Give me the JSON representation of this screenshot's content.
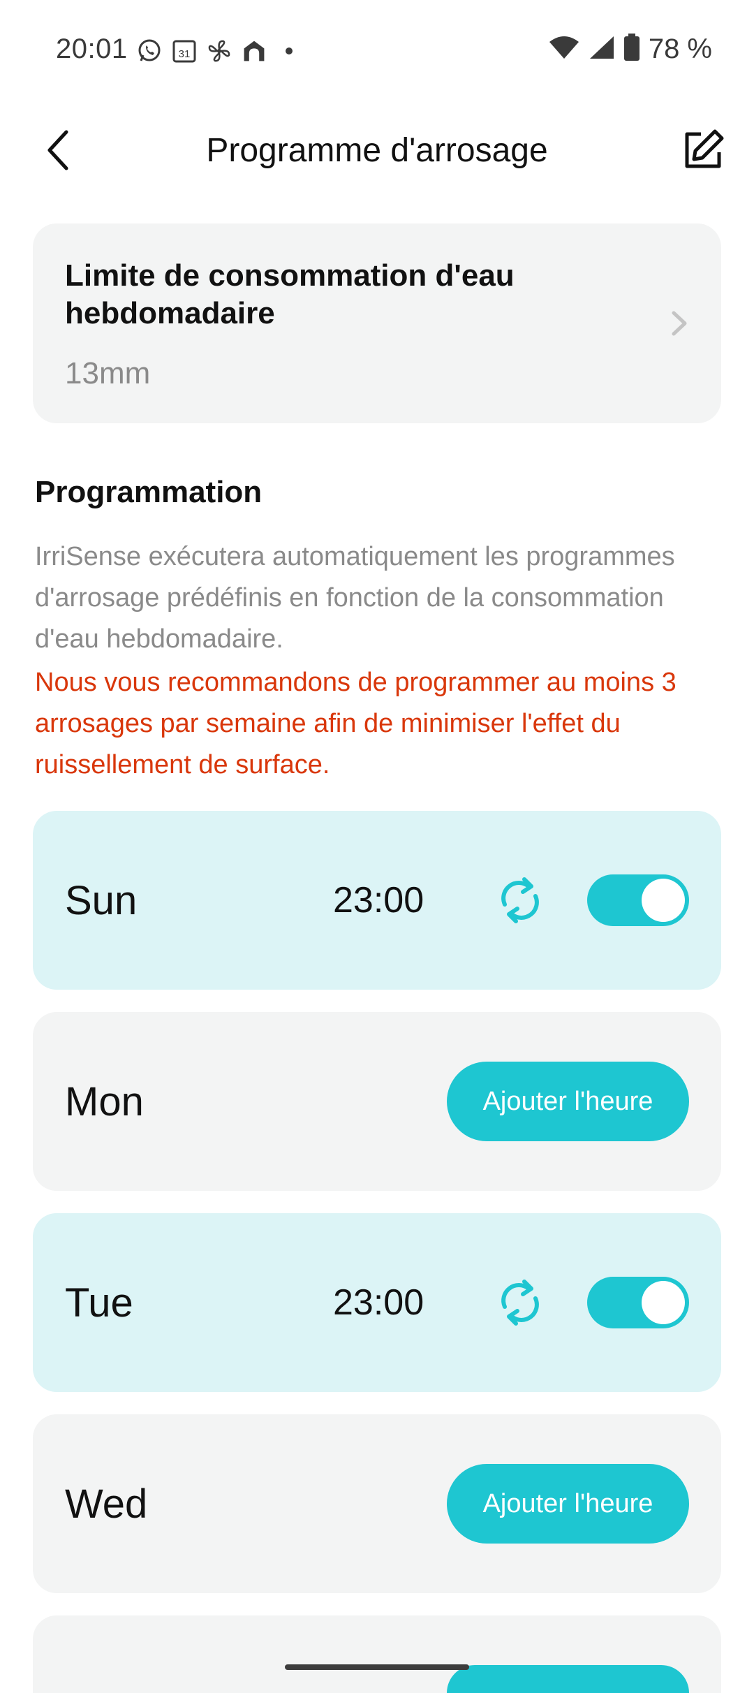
{
  "status_bar": {
    "time": "20:01",
    "battery": "78 %",
    "icons": [
      "whatsapp-icon",
      "calendar-icon",
      "fan-icon",
      "home-icon",
      "dot-icon",
      "wifi-icon",
      "signal-icon",
      "battery-icon"
    ],
    "calendar_day": "31"
  },
  "header": {
    "title": "Programme d'arrosage",
    "back_icon": "back-arrow-icon",
    "edit_icon": "edit-icon"
  },
  "limit_card": {
    "title": "Limite de consommation d'eau hebdomadaire",
    "value": "13mm"
  },
  "programmation": {
    "title": "Programmation",
    "description": "IrriSense exécutera automatiquement les programmes d'arrosage prédéfinis en fonction de la consommation d'eau hebdomadaire.",
    "warning": "Nous vous recommandons de programmer au moins 3 arrosages par semaine afin de minimiser l'effet du ruissellement de surface."
  },
  "days": [
    {
      "label": "Sun",
      "time": "23:00",
      "enabled": true
    },
    {
      "label": "Mon",
      "button": "Ajouter l'heure"
    },
    {
      "label": "Tue",
      "time": "23:00",
      "enabled": true
    },
    {
      "label": "Wed",
      "button": "Ajouter l'heure"
    }
  ],
  "colors": {
    "accent": "#1ec6d1",
    "active_card": "#dcf4f6",
    "card": "#f3f4f4",
    "warning": "#d9370b",
    "muted_text": "#8a8a8a"
  }
}
